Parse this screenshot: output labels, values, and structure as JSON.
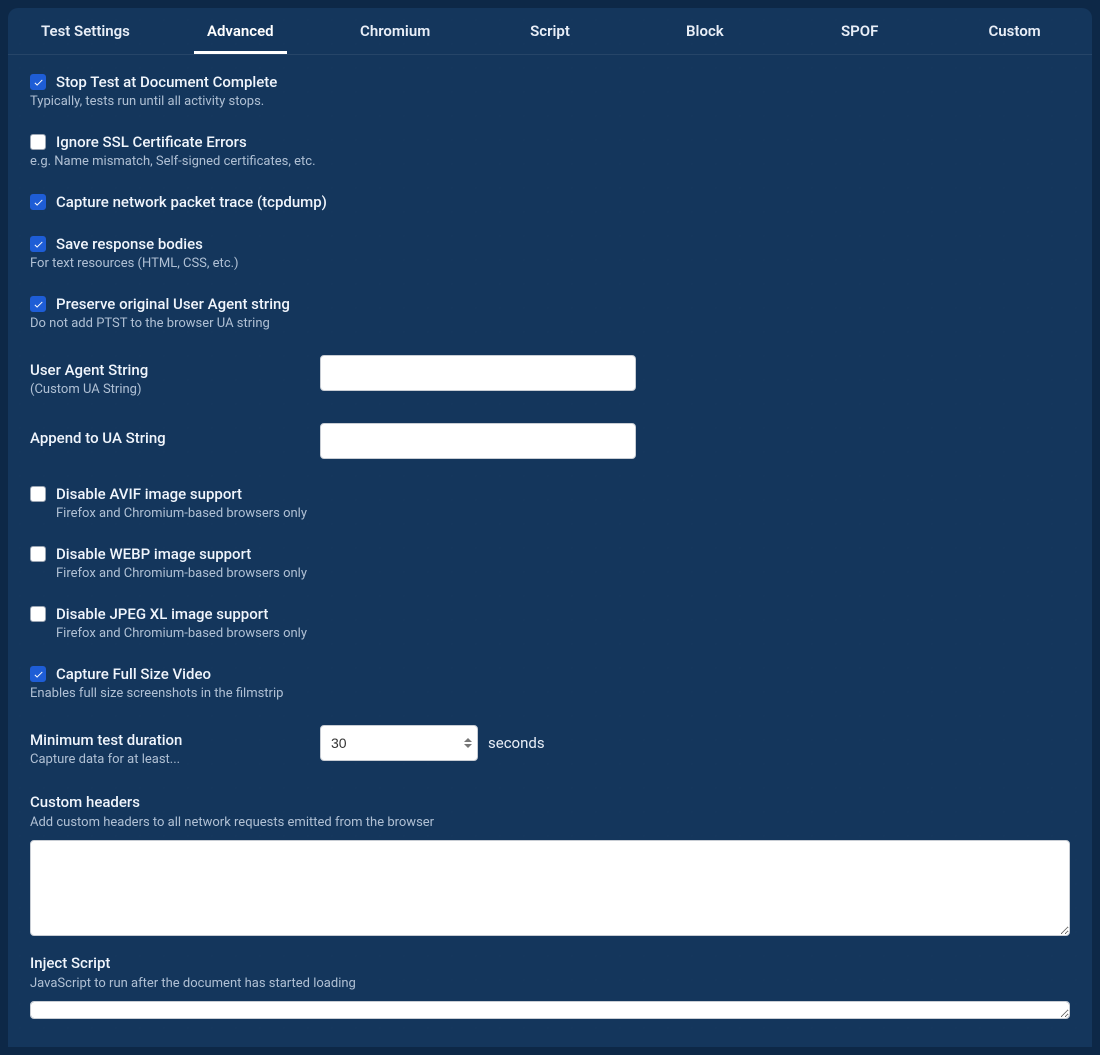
{
  "tabs": [
    {
      "label": "Test Settings",
      "active": false
    },
    {
      "label": "Advanced",
      "active": true
    },
    {
      "label": "Chromium",
      "active": false
    },
    {
      "label": "Script",
      "active": false
    },
    {
      "label": "Block",
      "active": false
    },
    {
      "label": "SPOF",
      "active": false
    },
    {
      "label": "Custom",
      "active": false
    }
  ],
  "options": {
    "stop_test": {
      "label": "Stop Test at Document Complete",
      "help": "Typically, tests run until all activity stops.",
      "checked": true
    },
    "ignore_ssl": {
      "label": "Ignore SSL Certificate Errors",
      "help": "e.g. Name mismatch, Self-signed certificates, etc.",
      "checked": false
    },
    "tcpdump": {
      "label": "Capture network packet trace (tcpdump)",
      "checked": true
    },
    "save_bodies": {
      "label": "Save response bodies",
      "help": "For text resources (HTML, CSS, etc.)",
      "checked": true
    },
    "preserve_ua": {
      "label": "Preserve original User Agent string",
      "help": "Do not add PTST to the browser UA string",
      "checked": true
    },
    "ua_string": {
      "label": "User Agent String",
      "help": "(Custom UA String)",
      "value": ""
    },
    "append_ua": {
      "label": "Append to UA String",
      "value": ""
    },
    "disable_avif": {
      "label": "Disable AVIF image support",
      "help": "Firefox and Chromium-based browsers only",
      "checked": false
    },
    "disable_webp": {
      "label": "Disable WEBP image support",
      "help": "Firefox and Chromium-based browsers only",
      "checked": false
    },
    "disable_jpegxl": {
      "label": "Disable JPEG XL image support",
      "help": "Firefox and Chromium-based browsers only",
      "checked": false
    },
    "full_video": {
      "label": "Capture Full Size Video",
      "help": "Enables full size screenshots in the filmstrip",
      "checked": true
    },
    "min_duration": {
      "label": "Minimum test duration",
      "help": "Capture data for at least...",
      "value": "30",
      "suffix": "seconds"
    },
    "custom_headers": {
      "label": "Custom headers",
      "help": "Add custom headers to all network requests emitted from the browser",
      "value": ""
    },
    "inject_script": {
      "label": "Inject Script",
      "help": "JavaScript to run after the document has started loading",
      "value": ""
    }
  }
}
